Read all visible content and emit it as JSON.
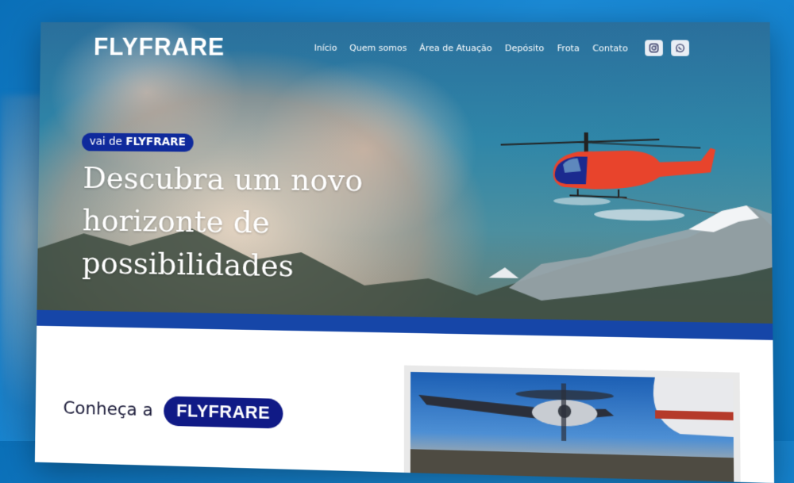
{
  "site": {
    "logo": "FLYFRARE"
  },
  "nav": {
    "items": [
      "Início",
      "Quem somos",
      "Área de Atuação",
      "Depósito",
      "Frota",
      "Contato"
    ]
  },
  "social": {
    "icons": [
      "instagram-icon",
      "whatsapp-icon"
    ]
  },
  "hero": {
    "tagline_prefix": "vai de",
    "tagline_brand": "FLYFRARE",
    "headline": "Descubra um novo horizonte de possibilidades"
  },
  "intro": {
    "text": "Conheça a",
    "brand": "FLYFRARE"
  },
  "colors": {
    "brand_dark_blue": "#101a86",
    "strip_blue": "#1646a8",
    "helicopter_red": "#e8442c",
    "background_blue": "#0b78c4"
  }
}
